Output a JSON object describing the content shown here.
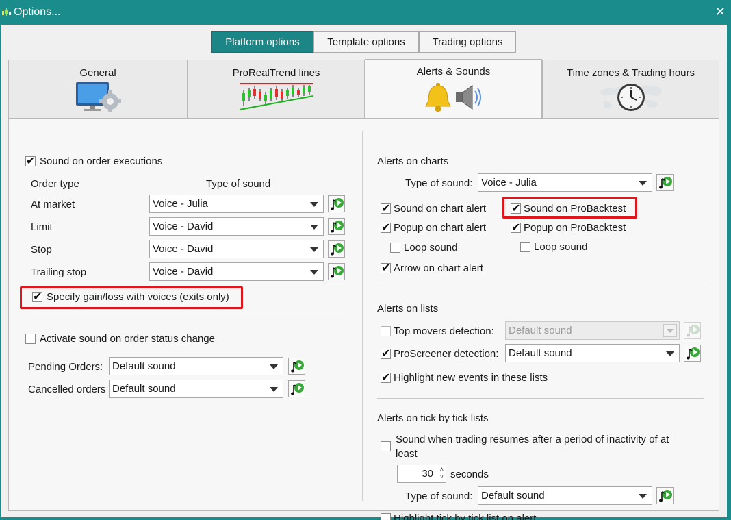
{
  "window": {
    "title": "Options...",
    "close": "✕"
  },
  "top_tabs": [
    {
      "label": "Platform options",
      "active": true
    },
    {
      "label": "Template options",
      "active": false
    },
    {
      "label": "Trading options",
      "active": false
    }
  ],
  "category_tabs": [
    {
      "label": "General",
      "icon": "computer-gear-icon"
    },
    {
      "label": "ProRealTrend lines",
      "icon": "trend-lines-icon"
    },
    {
      "label": "Alerts & Sounds",
      "icon": "bell-speaker-icon",
      "active": true
    },
    {
      "label": "Time zones & Trading hours",
      "icon": "world-clock-icon"
    }
  ],
  "left": {
    "sound_on_exec": {
      "label": "Sound on order executions",
      "checked": true
    },
    "col_order_type": "Order type",
    "col_type_of_sound": "Type of sound",
    "rows": [
      {
        "label": "At market",
        "value": "Voice - Julia"
      },
      {
        "label": "Limit",
        "value": "Voice - David"
      },
      {
        "label": "Stop",
        "value": "Voice - David"
      },
      {
        "label": "Trailing stop",
        "value": "Voice - David"
      }
    ],
    "specify_gain": {
      "label": "Specify gain/loss with voices (exits only)",
      "checked": true
    },
    "activate_status": {
      "label": "Activate sound on order status change",
      "checked": false
    },
    "pending": {
      "label": "Pending Orders:",
      "value": "Default sound"
    },
    "cancelled": {
      "label": "Cancelled orders",
      "value": "Default sound"
    }
  },
  "right": {
    "charts_heading": "Alerts on charts",
    "type_of_sound_label": "Type of sound:",
    "type_of_sound_value": "Voice - Julia",
    "sound_chart_alert": {
      "label": "Sound on chart alert",
      "checked": true
    },
    "sound_probacktest": {
      "label": "Sound on ProBacktest",
      "checked": true
    },
    "popup_chart_alert": {
      "label": "Popup on chart alert",
      "checked": true
    },
    "popup_probacktest": {
      "label": "Popup on ProBacktest",
      "checked": true
    },
    "loop_sound_1": {
      "label": "Loop sound",
      "checked": false
    },
    "loop_sound_2": {
      "label": "Loop sound",
      "checked": false
    },
    "arrow_chart_alert": {
      "label": "Arrow on chart alert",
      "checked": true
    },
    "lists_heading": "Alerts on lists",
    "top_movers": {
      "label": "Top movers detection:",
      "value": "Default sound",
      "checked": false,
      "disabled": true
    },
    "proscreener": {
      "label": "ProScreener detection:",
      "value": "Default sound",
      "checked": true
    },
    "highlight_new": {
      "label": "Highlight new events in these lists",
      "checked": true
    },
    "tick_heading": "Alerts on tick by tick lists",
    "sound_resume": {
      "label_line1": "Sound when trading resumes after a period of inactivity of at",
      "label_line2": "least",
      "checked": false
    },
    "seconds_value": "30",
    "seconds_label": "seconds",
    "tick_type_label": "Type of sound:",
    "tick_type_value": "Default sound",
    "highlight_tick": {
      "label": "Highlight tick by tick list on alert",
      "checked": false
    }
  },
  "colors": {
    "accent": "#1a8c8c",
    "highlight_border": "#e0161c"
  }
}
